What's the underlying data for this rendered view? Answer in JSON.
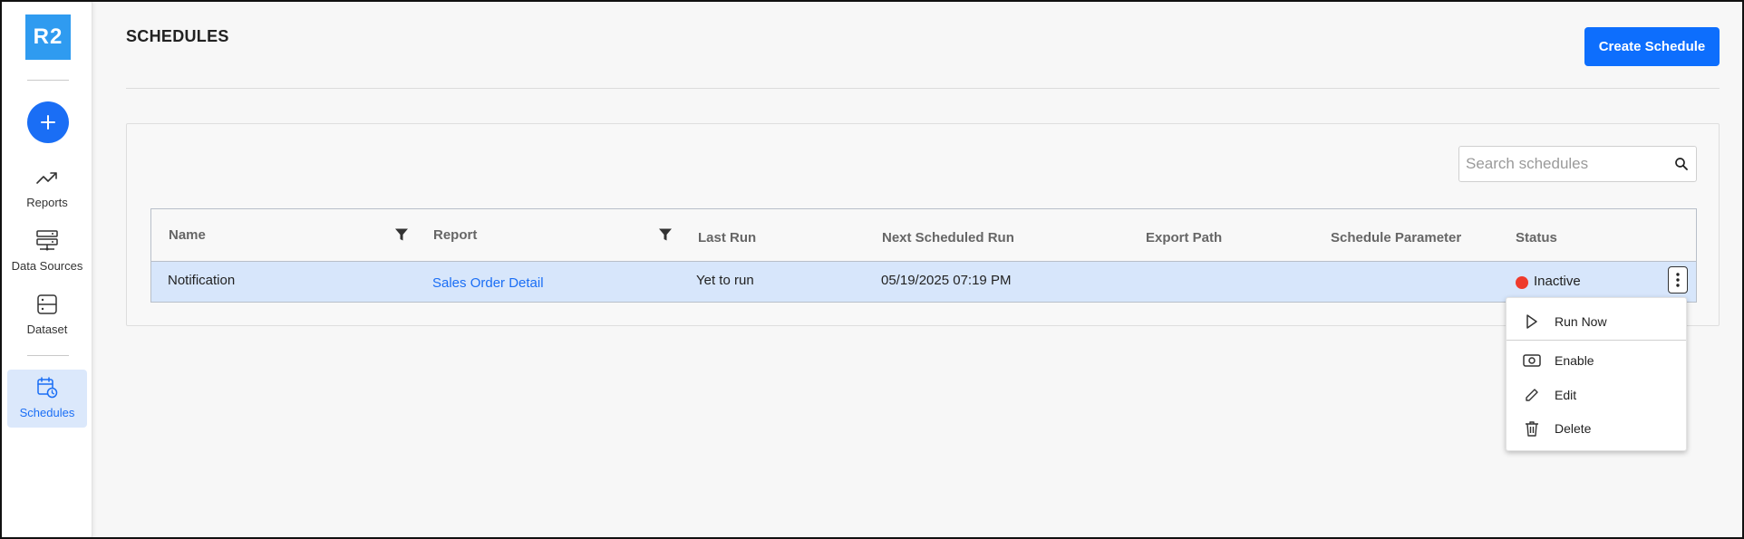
{
  "app": {
    "logo_text": "R2"
  },
  "sidebar": {
    "items": [
      {
        "label": "Reports",
        "icon": "trending-up-icon"
      },
      {
        "label": "Data Sources",
        "icon": "server-icon"
      },
      {
        "label": "Dataset",
        "icon": "dataset-icon"
      },
      {
        "label": "Schedules",
        "icon": "calendar-clock-icon",
        "active": true
      }
    ]
  },
  "header": {
    "title": "SCHEDULES",
    "create_label": "Create Schedule"
  },
  "search": {
    "placeholder": "Search schedules",
    "value": ""
  },
  "table": {
    "columns": [
      "Name",
      "Report",
      "Last Run",
      "Next Scheduled Run",
      "Export Path",
      "Schedule Parameter",
      "Status"
    ],
    "rows": [
      {
        "name": "Notification",
        "report": "Sales Order Detail",
        "last_run": "Yet to run",
        "next_run": "05/19/2025 07:19 PM",
        "export_path": "",
        "schedule_parameter": "",
        "status": "Inactive"
      }
    ]
  },
  "context_menu": {
    "items": [
      {
        "label": "Run Now",
        "icon": "play-icon"
      },
      {
        "label": "Enable",
        "icon": "enable-icon"
      },
      {
        "label": "Edit",
        "icon": "pencil-icon"
      },
      {
        "label": "Delete",
        "icon": "trash-icon"
      }
    ]
  },
  "colors": {
    "accent": "#0d6efd",
    "row_selected": "#d7e6fb",
    "status_inactive": "#ef3b2c",
    "logo_bg": "#2f9bf0"
  }
}
